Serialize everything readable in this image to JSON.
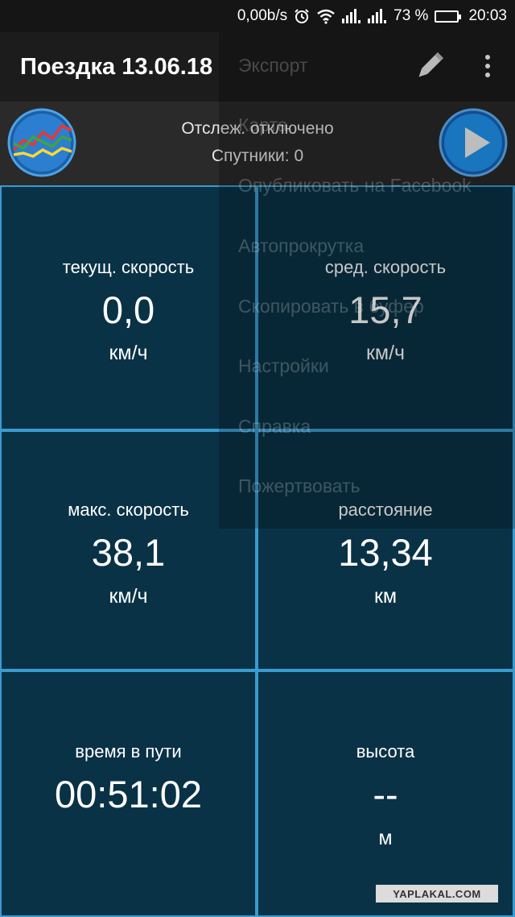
{
  "statusbar": {
    "network_speed": "0,00b/s",
    "battery_percent": "73 %",
    "battery_level": 0.73,
    "time": "20:03",
    "icons": [
      "alarm-icon",
      "wifi-icon",
      "signal-icon",
      "signal-icon",
      "battery-icon"
    ]
  },
  "appbar": {
    "title": "Поездка 13.06.18",
    "icons": [
      "pencil-icon",
      "more-vert-icon"
    ]
  },
  "tracking": {
    "status_line": "Отслеж. отключено",
    "satellites_line": "Спутники: 0",
    "icons": [
      "chart-icon",
      "play-icon"
    ]
  },
  "cells": {
    "current_speed": {
      "label": "текущ. скорость",
      "value": "0,0",
      "unit": "км/ч"
    },
    "avg_speed": {
      "label": "сред. скорость",
      "value": "15,7",
      "unit": "км/ч"
    },
    "max_speed": {
      "label": "макс. скорость",
      "value": "38,1",
      "unit": "км/ч"
    },
    "distance": {
      "label": "расстояние",
      "value": "13,34",
      "unit": "км"
    },
    "moving_time": {
      "label": "время в пути",
      "value": "00:51:02",
      "unit": ""
    },
    "altitude": {
      "label": "высота",
      "value": "--",
      "unit": "м"
    }
  },
  "menu": {
    "items": [
      "Экспорт",
      "Карта",
      "Опубликовать на Facebook",
      "Автопрокрутка",
      "Скопировать в буфер",
      "Настройки",
      "Справка",
      "Пожертвовать"
    ]
  },
  "watermark": "YAPLAKAL.COM",
  "colors": {
    "cell_bg": "#0a3246",
    "grid_line": "#3a9bd1",
    "appbar_bg": "#1c1c1c",
    "trackbar_bg": "#2a2a2a"
  }
}
